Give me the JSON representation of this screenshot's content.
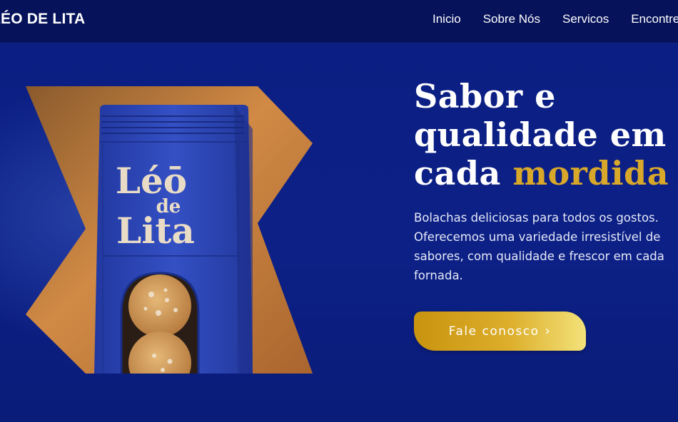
{
  "nav": {
    "brand": "LÉO DE LITA",
    "links": [
      "Inicio",
      "Sobre Nós",
      "Servicos",
      "Encontre-nos"
    ]
  },
  "hero": {
    "headline_line1": "Sabor e",
    "headline_line2": "qualidade em",
    "headline_line3_start": "cada ",
    "headline_accent": "mordida",
    "subtext": "Bolachas deliciosas para todos os gostos. Oferecemos uma variedade irresistível de sabores, com qualidade e frescor em cada fornada.",
    "cta_label": "Fale conosco",
    "cta_chevron": "›"
  },
  "product": {
    "logo_top": "Léō",
    "logo_mid": "de",
    "logo_bottom": "Lita"
  },
  "colors": {
    "background": "#0b1f7a",
    "navbar": "#061259",
    "accent_gold": "#d8a82a",
    "package_blue": "#2e48b8",
    "backdrop_orange": "#c9813e"
  }
}
